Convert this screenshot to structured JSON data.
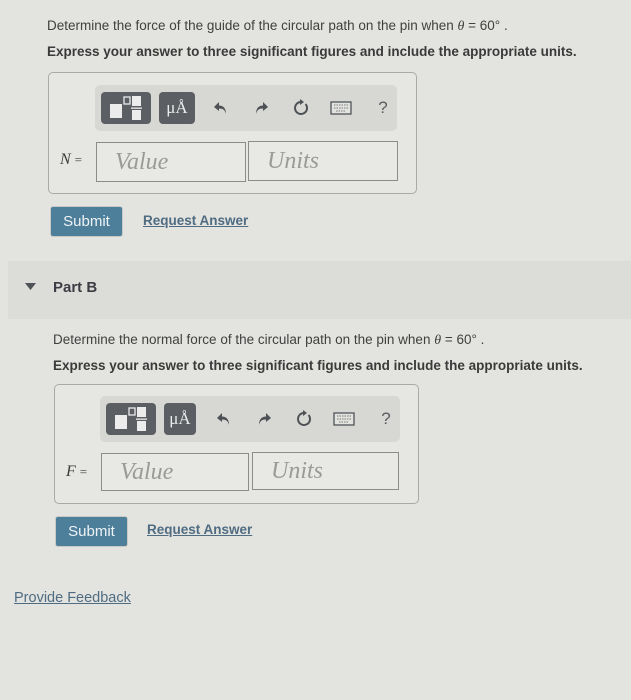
{
  "part_a": {
    "prompt_prefix": "Determine the force of the guide of the circular path on the pin when ",
    "theta_symbol": "θ",
    "theta_value": " = 60°",
    "prompt_suffix": " .",
    "instruction": "Express your answer to three significant figures and include the appropriate units.",
    "variable": "N",
    "equals": "=",
    "value_placeholder": "Value",
    "units_placeholder": "Units",
    "submit_label": "Submit",
    "request_answer_label": "Request Answer"
  },
  "toolbar": {
    "templates_icon": "fraction-template-icon",
    "units_label": "μÅ",
    "undo_icon": "undo-icon",
    "redo_icon": "redo-icon",
    "reset_icon": "reset-icon",
    "keyboard_icon": "keyboard-icon",
    "help_label": "?"
  },
  "part_b": {
    "header": "Part B",
    "toggle_icon": "caret-down-icon",
    "prompt_prefix": "Determine the normal force of the circular path on the pin when ",
    "theta_symbol": "θ",
    "theta_value": " = 60°",
    "prompt_suffix": " .",
    "instruction": "Express your answer to three significant figures and include the appropriate units.",
    "variable": "F",
    "equals": "=",
    "value_placeholder": "Value",
    "units_placeholder": "Units",
    "submit_label": "Submit",
    "request_answer_label": "Request Answer"
  },
  "footer": {
    "feedback_label": "Provide Feedback"
  }
}
